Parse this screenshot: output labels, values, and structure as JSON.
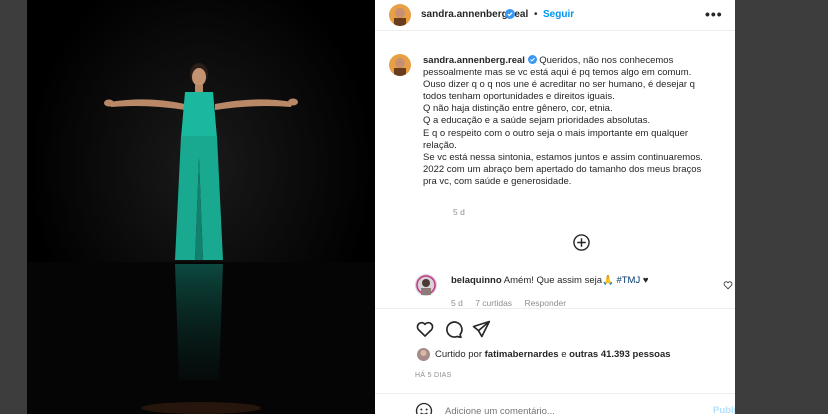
{
  "post": {
    "username": "sandra.annenberg.real",
    "follow_label": "Seguir",
    "separator": "•",
    "more_label": "•••"
  },
  "caption": {
    "username": "sandra.annenberg.real",
    "lines": [
      "Queridos, não nos conhecemos",
      "pessoalmente mas se vc está aqui é pq temos algo em comum.",
      "Ouso dizer q o q nos une é acreditar no ser humano, é desejar q",
      "todos tenham oportunidades e direitos iguais.",
      "Q não haja distinção entre gênero, cor, etnia.",
      "Q a educação e a saúde sejam prioridades absolutas.",
      "E q o respeito com o outro seja o mais importante em qualquer",
      "relação.",
      "Se vc está nessa sintonia, estamos juntos e assim continuaremos.",
      "2022 com um abraço bem apertado do tamanho dos meus braços",
      "pra vc, com saúde e generosidade."
    ],
    "time": "5 d"
  },
  "comment": {
    "username": "belaquinno",
    "text": "Amém! Que assim seja🙏",
    "tag": "#TMJ",
    "heart": "♥",
    "time": "5 d",
    "likes": "7 curtidas",
    "reply": "Responder"
  },
  "likes": {
    "prefix": "Curtido por",
    "user": "fatimabernardes",
    "middle": "e",
    "others": "outras 41.393 pessoas"
  },
  "date": "HÁ 5 DIAS",
  "add_comment": {
    "placeholder": "Adicione um comentário...",
    "post_label": "Publicar"
  },
  "icons": {
    "verified": "verified-badge-icon",
    "load_more": "plus-circle-icon",
    "like": "heart-icon",
    "comment": "comment-icon",
    "share": "paper-plane-icon",
    "save": "bookmark-icon",
    "emoji": "emoji-icon"
  },
  "colors": {
    "accent": "#0095f6",
    "verified": "#3897f0",
    "dress": "#1bb8a0",
    "stage": "#000000"
  }
}
